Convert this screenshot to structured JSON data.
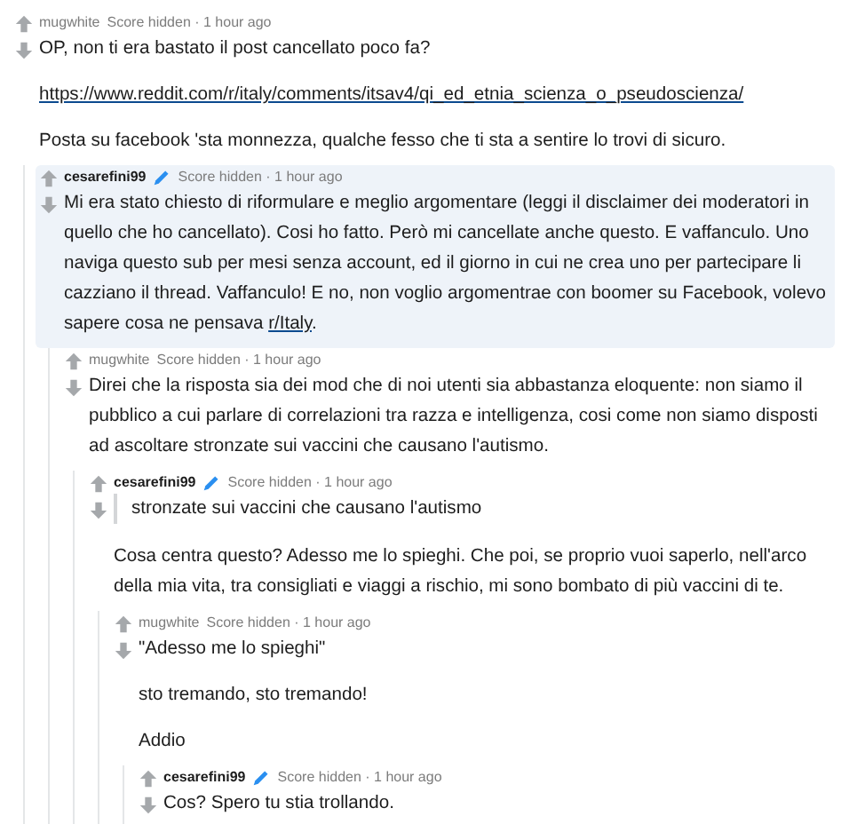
{
  "comments": [
    {
      "author": "mugwhite",
      "op": false,
      "meta": "Score hidden · 1 hour ago",
      "highlighted": false,
      "blocks": [
        {
          "kind": "paragraph",
          "spans": [
            {
              "kind": "text",
              "text": "OP, non ti era bastato il post cancellato poco fa?"
            }
          ]
        },
        {
          "kind": "paragraph",
          "spans": [
            {
              "kind": "link",
              "text": "https://www.reddit.com/r/italy/comments/itsav4/qi_ed_etnia_scienza_o_pseudoscienza/"
            }
          ]
        },
        {
          "kind": "paragraph",
          "spans": [
            {
              "kind": "text",
              "text": "Posta su facebook 'sta monnezza, qualche fesso che ti sta a sentire lo trovi di sicuro."
            }
          ]
        }
      ],
      "children": [
        {
          "author": "cesarefini99",
          "op": true,
          "meta": "Score hidden · 1 hour ago",
          "highlighted": true,
          "blocks": [
            {
              "kind": "paragraph",
              "spans": [
                {
                  "kind": "text",
                  "text": "Mi era stato chiesto di riformulare e meglio argomentare (leggi il disclaimer dei moderatori in quello che ho cancellato). Cosi ho fatto. Però mi cancellate anche questo. E vaffanculo. Uno naviga questo sub per mesi senza account, ed il giorno in cui ne crea uno per partecipare li cazziano il thread. Vaffanculo! E no, non voglio argomentrae con boomer su Facebook, volevo sapere cosa ne pensava "
                },
                {
                  "kind": "link",
                  "text": "r/Italy"
                },
                {
                  "kind": "text",
                  "text": "."
                }
              ]
            }
          ],
          "children": [
            {
              "author": "mugwhite",
              "op": false,
              "meta": "Score hidden · 1 hour ago",
              "highlighted": false,
              "blocks": [
                {
                  "kind": "paragraph",
                  "spans": [
                    {
                      "kind": "text",
                      "text": "Direi che la risposta sia dei mod che di noi utenti sia abbastanza eloquente: non siamo il pubblico a cui parlare di correlazioni tra razza e intelligenza, cosi come non siamo disposti ad ascoltare stronzate sui vaccini che causano l'autismo."
                    }
                  ]
                }
              ],
              "children": [
                {
                  "author": "cesarefini99",
                  "op": true,
                  "meta": "Score hidden · 1 hour ago",
                  "highlighted": false,
                  "blocks": [
                    {
                      "kind": "quote",
                      "spans": [
                        {
                          "kind": "text",
                          "text": "stronzate sui vaccini che causano l'autismo"
                        }
                      ]
                    },
                    {
                      "kind": "paragraph",
                      "spans": [
                        {
                          "kind": "text",
                          "text": "Cosa centra questo? Adesso me lo spieghi. Che poi, se proprio vuoi saperlo, nell'arco della mia vita, tra consigliati e viaggi a rischio, mi sono bombato di più vaccini di te."
                        }
                      ]
                    }
                  ],
                  "children": [
                    {
                      "author": "mugwhite",
                      "op": false,
                      "meta": "Score hidden · 1 hour ago",
                      "highlighted": false,
                      "blocks": [
                        {
                          "kind": "paragraph",
                          "spans": [
                            {
                              "kind": "text",
                              "text": "\"Adesso me lo spieghi\""
                            }
                          ]
                        },
                        {
                          "kind": "paragraph",
                          "spans": [
                            {
                              "kind": "text",
                              "text": "sto tremando, sto tremando!"
                            }
                          ]
                        },
                        {
                          "kind": "paragraph",
                          "spans": [
                            {
                              "kind": "text",
                              "text": "Addio"
                            }
                          ]
                        }
                      ],
                      "children": [
                        {
                          "author": "cesarefini99",
                          "op": true,
                          "meta": "Score hidden · 1 hour ago",
                          "highlighted": false,
                          "blocks": [
                            {
                              "kind": "paragraph",
                              "spans": [
                                {
                                  "kind": "text",
                                  "text": "Cos? Spero tu stia trollando."
                                }
                              ]
                            }
                          ]
                        }
                      ]
                    }
                  ]
                }
              ]
            }
          ]
        }
      ]
    }
  ]
}
